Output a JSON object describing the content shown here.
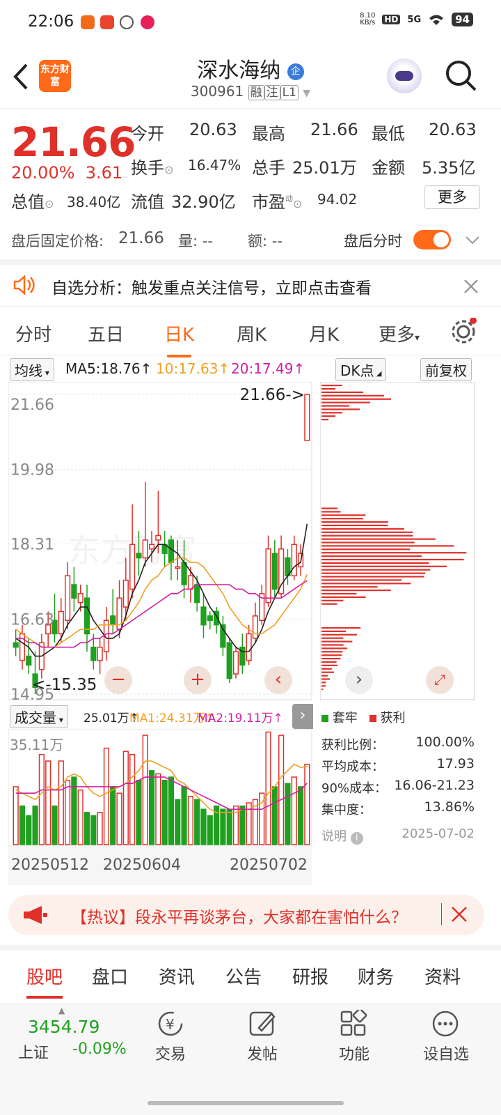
{
  "status_bar": {
    "time": "22:06",
    "net_speed_top": "8.10",
    "net_speed_bottom": "KB/s",
    "hd": "HD",
    "signal": "5G",
    "battery": "94"
  },
  "header": {
    "logo_text": "东方财富",
    "stock_name": "深水海纳",
    "enterprise_badge": "企",
    "code": "300961",
    "tag1": "融",
    "tag2": "注",
    "tag3": "L1"
  },
  "quote": {
    "price": "21.66",
    "change_pct": "20.00%",
    "change_amt": "3.61",
    "open_label": "今开",
    "open": "20.63",
    "high_label": "最高",
    "high": "21.66",
    "low_label": "最低",
    "low": "20.63",
    "turnover_label": "换手",
    "turnover": "16.47%",
    "volume_label": "总手",
    "volume": "25.01万",
    "amount_label": "金额",
    "amount": "5.35亿",
    "mktcap_label": "总值",
    "mktcap": "38.40亿",
    "float_label": "流值",
    "float": "32.90亿",
    "pe_label": "市盈",
    "pe_sup": "动",
    "pe": "94.02",
    "more_label": "更多"
  },
  "after_hours": {
    "price_label": "盘后固定价格:",
    "price": "21.66",
    "vol_label": "量:",
    "vol": "--",
    "amt_label": "额:",
    "amt": "--",
    "toggle_label": "盘后分时"
  },
  "alert": {
    "text": "自选分析：触发重点关注信号，立即点击查看"
  },
  "chart_tabs": [
    "分时",
    "五日",
    "日K",
    "周K",
    "月K",
    "更多"
  ],
  "active_tab": "日K",
  "chart_bar": {
    "ma_button": "均线",
    "ma5": "MA5:18.76↑",
    "ma10": "10:17.63↑",
    "ma20": "20:17.49↑",
    "dk_button": "DK点",
    "adjust_button": "前复权"
  },
  "colors": {
    "up": "#e0302a",
    "down": "#20a020",
    "ma5": "#222222",
    "ma10": "#f0a020",
    "ma20": "#d020a0",
    "accent": "#ff6a1a"
  },
  "chart_data": [
    {
      "type": "candlestick",
      "y_ticks": [
        "21.66",
        "19.98",
        "18.31",
        "16.63",
        "14.95"
      ],
      "ylim": [
        14.95,
        21.66
      ],
      "last_price_label": "21.66->",
      "low_marker_label": "<-15.35",
      "x_ticks": [
        "20250512",
        "20250604",
        "20250702"
      ],
      "candles": [
        [
          16.1,
          16.0,
          16.4,
          15.8
        ],
        [
          15.7,
          16.3,
          16.5,
          15.5
        ],
        [
          15.8,
          15.6,
          16.2,
          15.4
        ],
        [
          15.4,
          15.1,
          15.9,
          14.95
        ],
        [
          15.5,
          16.1,
          16.3,
          15.3
        ],
        [
          16.3,
          16.5,
          16.8,
          16.0
        ],
        [
          16.6,
          16.3,
          17.2,
          16.1
        ],
        [
          16.3,
          16.8,
          17.1,
          16.1
        ],
        [
          16.6,
          17.6,
          17.9,
          16.4
        ],
        [
          17.4,
          17.1,
          17.8,
          16.8
        ],
        [
          17.0,
          17.2,
          17.4,
          16.8
        ],
        [
          17.1,
          16.3,
          17.4,
          15.9
        ],
        [
          16.0,
          15.7,
          16.3,
          15.5
        ],
        [
          15.7,
          16.0,
          16.2,
          15.4
        ],
        [
          15.9,
          16.6,
          16.9,
          15.7
        ],
        [
          16.7,
          16.5,
          17.3,
          16.3
        ],
        [
          16.4,
          17.1,
          17.5,
          16.2
        ],
        [
          16.9,
          17.5,
          18.0,
          16.6
        ],
        [
          17.3,
          18.3,
          19.2,
          17.1
        ],
        [
          18.1,
          18.0,
          18.6,
          17.6
        ],
        [
          18.0,
          18.4,
          19.7,
          17.8
        ],
        [
          18.2,
          18.3,
          18.6,
          17.9
        ],
        [
          18.4,
          18.5,
          19.5,
          18.1
        ],
        [
          18.3,
          18.1,
          18.6,
          17.8
        ],
        [
          18.4,
          17.9,
          18.5,
          17.5
        ],
        [
          17.8,
          17.8,
          18.4,
          17.5
        ],
        [
          17.9,
          17.4,
          18.4,
          17.1
        ],
        [
          17.3,
          17.6,
          17.8,
          17.0
        ],
        [
          17.4,
          17.0,
          17.6,
          16.8
        ],
        [
          16.9,
          16.5,
          17.2,
          16.2
        ],
        [
          16.7,
          16.6,
          16.8,
          16.4
        ],
        [
          16.8,
          16.5,
          16.9,
          16.3
        ],
        [
          16.5,
          16.0,
          16.7,
          15.8
        ],
        [
          16.1,
          15.3,
          16.2,
          15.2
        ],
        [
          15.4,
          15.9,
          16.0,
          15.3
        ],
        [
          16.0,
          15.6,
          16.3,
          15.4
        ],
        [
          15.7,
          16.3,
          16.5,
          15.6
        ],
        [
          16.2,
          16.7,
          17.0,
          16.1
        ],
        [
          16.6,
          17.2,
          17.4,
          16.5
        ],
        [
          17.0,
          18.2,
          18.5,
          16.9
        ],
        [
          18.1,
          17.3,
          18.4,
          17.1
        ],
        [
          17.2,
          18.2,
          18.5,
          17.1
        ],
        [
          18.0,
          17.6,
          18.2,
          17.4
        ],
        [
          17.6,
          18.3,
          18.5,
          17.5
        ],
        [
          17.8,
          18.1,
          18.3,
          17.6
        ],
        [
          20.63,
          21.66,
          21.66,
          20.63
        ]
      ],
      "ma5": [
        16.2,
        16.1,
        16.0,
        15.8,
        15.8,
        15.9,
        16.0,
        16.2,
        16.5,
        16.7,
        16.9,
        16.9,
        16.6,
        16.4,
        16.2,
        16.2,
        16.3,
        16.7,
        17.2,
        17.5,
        17.9,
        18.1,
        18.3,
        18.3,
        18.2,
        18.1,
        17.9,
        17.7,
        17.5,
        17.2,
        16.9,
        16.7,
        16.4,
        16.2,
        16.0,
        15.9,
        15.9,
        16.1,
        16.4,
        16.8,
        17.1,
        17.4,
        17.6,
        17.8,
        17.9,
        18.76
      ],
      "ma10": [
        16.4,
        16.3,
        16.2,
        16.1,
        16.0,
        16.0,
        16.0,
        16.1,
        16.2,
        16.3,
        16.4,
        16.4,
        16.4,
        16.5,
        16.5,
        16.5,
        16.5,
        16.6,
        16.8,
        17.0,
        17.3,
        17.5,
        17.6,
        17.8,
        17.9,
        18.0,
        18.0,
        17.9,
        17.9,
        17.8,
        17.6,
        17.4,
        17.2,
        16.9,
        16.7,
        16.5,
        16.4,
        16.3,
        16.3,
        16.4,
        16.5,
        16.7,
        16.9,
        17.1,
        17.3,
        17.63
      ],
      "ma20": [
        16.2,
        16.2,
        16.1,
        16.1,
        16.0,
        16.0,
        16.0,
        16.0,
        16.0,
        16.0,
        16.1,
        16.1,
        16.2,
        16.2,
        16.3,
        16.3,
        16.4,
        16.5,
        16.6,
        16.7,
        16.8,
        16.9,
        17.0,
        17.1,
        17.2,
        17.2,
        17.3,
        17.3,
        17.4,
        17.4,
        17.4,
        17.4,
        17.4,
        17.4,
        17.3,
        17.3,
        17.2,
        17.2,
        17.1,
        17.1,
        17.1,
        17.1,
        17.2,
        17.3,
        17.4,
        17.49
      ]
    },
    {
      "type": "bar",
      "title": "成交量",
      "total": "25.01万",
      "ma1_label": "MA1:24.31万",
      "ma2_label": "MA2:19.11万",
      "y_max_label": "35.11万",
      "ylim": [
        0,
        35.11
      ],
      "values": [
        18,
        12,
        9,
        12,
        28,
        26,
        12,
        26,
        20,
        21,
        17,
        10,
        9,
        10,
        30,
        18,
        16,
        29,
        28,
        20,
        34,
        23,
        22,
        20,
        21,
        14,
        18,
        15,
        14,
        11,
        9,
        12,
        11,
        11,
        12,
        12,
        13,
        14,
        16,
        35,
        18,
        34,
        19,
        21,
        18,
        25
      ],
      "up": [
        1,
        0,
        0,
        0,
        1,
        1,
        0,
        1,
        1,
        0,
        1,
        0,
        0,
        1,
        1,
        0,
        1,
        1,
        1,
        0,
        1,
        0,
        1,
        0,
        0,
        0,
        0,
        1,
        0,
        0,
        0,
        0,
        0,
        0,
        1,
        0,
        1,
        1,
        1,
        1,
        0,
        1,
        0,
        1,
        0,
        1
      ],
      "ma1": [
        17,
        16,
        15,
        14,
        16,
        18,
        17,
        18,
        21,
        22,
        21,
        18,
        16,
        15,
        16,
        17,
        18,
        19,
        21,
        23,
        26,
        26,
        25,
        24,
        23,
        20,
        19,
        17,
        15,
        13,
        11,
        10,
        10,
        10,
        10,
        11,
        11,
        12,
        13,
        16,
        18,
        21,
        23,
        25,
        24,
        24.31
      ],
      "ma2": [
        16,
        16,
        16,
        16,
        17,
        17,
        17,
        17,
        18,
        18,
        18,
        18,
        18,
        18,
        18,
        18,
        18,
        19,
        19,
        20,
        21,
        21,
        21,
        21,
        20,
        19,
        18,
        17,
        16,
        15,
        14,
        13,
        12,
        11,
        11,
        11,
        11,
        11,
        11,
        12,
        13,
        14,
        15,
        16,
        17,
        19.11
      ]
    }
  ],
  "chip": {
    "legend_trapped": "套牢",
    "legend_profit": "获利",
    "profit_ratio_label": "获利比例：",
    "profit_ratio": "100.00%",
    "avg_cost_label": "平均成本：",
    "avg_cost": "17.93",
    "cost90_label": "90%成本：",
    "cost90": "16.06-21.23",
    "concentration_label": "集中度：",
    "concentration": "13.86%",
    "note_label": "说明",
    "date": "2025-07-02"
  },
  "news": {
    "text": "【热议】段永平再谈茅台，大家都在害怕什么？"
  },
  "bottom_tabs": [
    "股吧",
    "盘口",
    "资讯",
    "公告",
    "研报",
    "财务",
    "资料"
  ],
  "active_bottom_tab": "股吧",
  "index": {
    "value": "3454.79",
    "name": "上证",
    "change": "-0.09%"
  },
  "bottom_nav": [
    "交易",
    "发帖",
    "功能",
    "设自选"
  ]
}
